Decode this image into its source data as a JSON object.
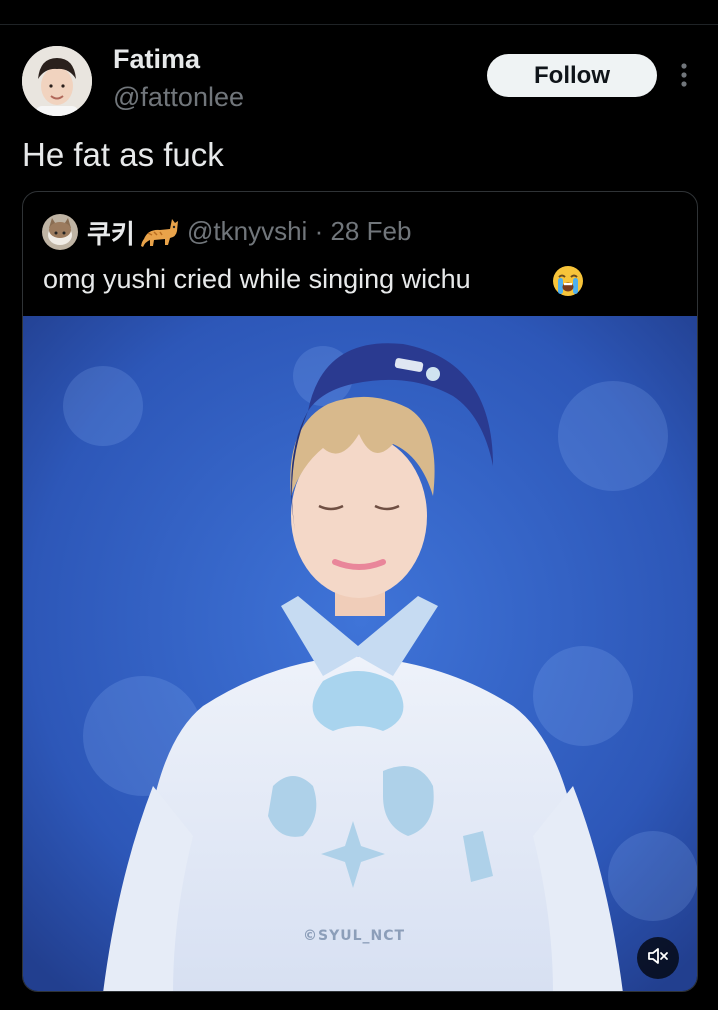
{
  "post": {
    "author": {
      "display_name": "Fatima",
      "handle": "@fattonlee"
    },
    "follow_label": "Follow",
    "text": "He fat as fuck"
  },
  "quoted": {
    "author": {
      "display_name": "쿠키",
      "name_emoji": "cat-emoji",
      "handle": "@tknyvshi"
    },
    "separator": "·",
    "date": "28 Feb",
    "text": "omg yushi cried while singing wichu",
    "text_emoji": "loudly-crying-face-emoji",
    "media": {
      "watermark": "©SYUL_NCT",
      "mute_icon": "speaker-muted-icon"
    }
  },
  "colors": {
    "background": "#000000",
    "text_primary": "#e7e9ea",
    "text_secondary": "#71767b",
    "border": "#2f3336",
    "follow_bg": "#eff3f4"
  }
}
